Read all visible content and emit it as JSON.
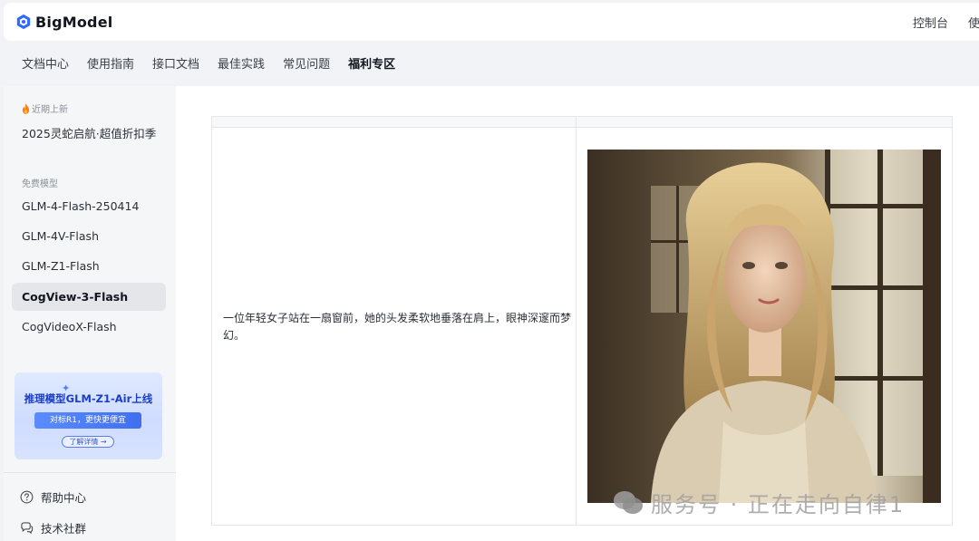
{
  "header": {
    "brand": "BigModel",
    "console_label": "控制台",
    "avatar_text": "使"
  },
  "nav": {
    "items": [
      {
        "label": "文档中心"
      },
      {
        "label": "使用指南"
      },
      {
        "label": "接口文档"
      },
      {
        "label": "最佳实践"
      },
      {
        "label": "常见问题"
      },
      {
        "label": "福利专区",
        "active": true
      }
    ]
  },
  "sidebar": {
    "recent_title": "近期上新",
    "recent_item": "2025灵蛇启航·超值折扣季",
    "free_title": "免费模型",
    "models": [
      {
        "label": "GLM-4-Flash-250414"
      },
      {
        "label": "GLM-4V-Flash"
      },
      {
        "label": "GLM-Z1-Flash"
      },
      {
        "label": "CogView-3-Flash",
        "active": true
      },
      {
        "label": "CogVideoX-Flash"
      }
    ],
    "promo": {
      "title": "推理模型GLM-Z1-Air上线",
      "subtitle": "对标R1，更快更便宜",
      "button": "了解详情 →"
    },
    "help_center": "帮助中心",
    "tech_community": "技术社群"
  },
  "main": {
    "prompt_text": "一位年轻女子站在一扇窗前，她的头发柔软地垂落在肩上，眼神深邃而梦幻。"
  },
  "watermark": "服务号 · 正在走向自律1",
  "colors": {
    "brand_blue": "#2f6bff",
    "active_bg": "#e4e6ea",
    "page_bg": "#f1f3f6"
  }
}
